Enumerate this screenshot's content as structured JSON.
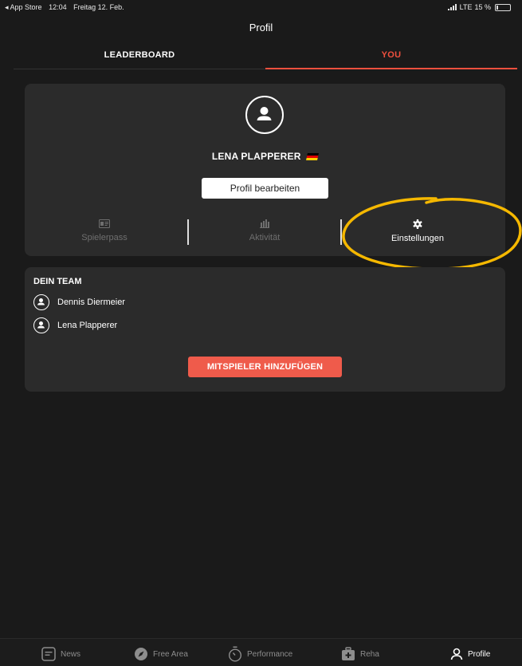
{
  "statusbar": {
    "back_app": "◂ App Store",
    "time": "12:04",
    "date": "Freitag 12. Feb.",
    "network": "LTE",
    "battery_text": "15 %",
    "battery_level": 0.15
  },
  "header": {
    "title": "Profil"
  },
  "tabs": [
    {
      "label": "LEADERBOARD"
    },
    {
      "label": "YOU"
    }
  ],
  "profile": {
    "name": "LENA PLAPPERER",
    "flag": "🇩🇪",
    "edit_label": "Profil bearbeiten",
    "quicklinks": [
      {
        "label": "Spielerpass",
        "icon": "id-card-icon"
      },
      {
        "label": "Aktivität",
        "icon": "bar-chart-icon"
      },
      {
        "label": "Einstellungen",
        "icon": "gear-icon"
      }
    ]
  },
  "team": {
    "title": "DEIN TEAM",
    "members": [
      {
        "name": "Dennis Diermeier"
      },
      {
        "name": "Lena Plapperer"
      }
    ],
    "add_label": "MITSPIELER HINZUFÜGEN"
  },
  "nav": [
    {
      "label": "News",
      "icon": "news-icon"
    },
    {
      "label": "Free Area",
      "icon": "compass-icon"
    },
    {
      "label": "Performance",
      "icon": "stopwatch-icon"
    },
    {
      "label": "Reha",
      "icon": "medical-kit-icon"
    },
    {
      "label": "Profile",
      "icon": "user-icon"
    }
  ],
  "colors": {
    "accent": "#f0503e",
    "background": "#1a1a1a",
    "card": "#2b2b2b",
    "annotation": "#f5b800"
  }
}
